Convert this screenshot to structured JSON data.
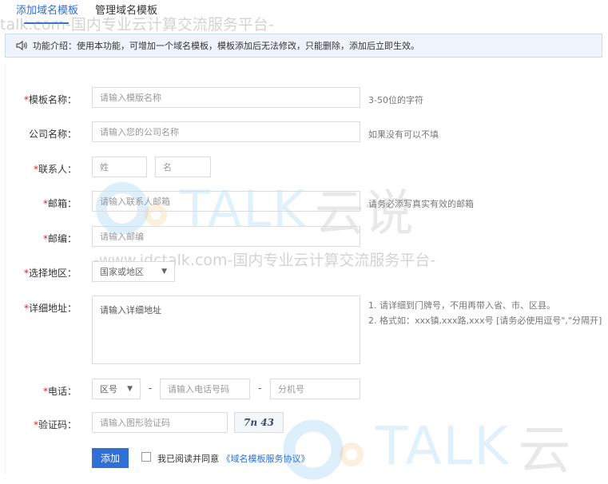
{
  "tabs": [
    {
      "label": "添加域名模板"
    },
    {
      "label": "管理域名模板"
    }
  ],
  "banner": {
    "icon": "speaker-icon",
    "text": "功能介绍：使用本功能，可增加一个域名模板，模板添加后无法修改，只能删除，添加后立即生效。"
  },
  "form": {
    "template_name": {
      "label": "模板名称：",
      "required": true,
      "placeholder": "请输入模版名称",
      "hint": "3-50位的字符"
    },
    "company": {
      "label": "公司名称：",
      "required": false,
      "placeholder": "请输入您的公司名称",
      "hint": "如果没有可以不填"
    },
    "contact": {
      "label": "联系人：",
      "required": true,
      "surname_placeholder": "姓",
      "name_placeholder": "名"
    },
    "email": {
      "label": "邮箱：",
      "required": true,
      "placeholder": "请输入联系人邮箱",
      "hint": "请务必添写真实有效的邮箱"
    },
    "postcode": {
      "label": "邮编：",
      "required": true,
      "placeholder": "请输入邮编"
    },
    "region": {
      "label": "选择地区：",
      "required": true,
      "selected": "国家或地区"
    },
    "address": {
      "label": "详细地址：",
      "required": true,
      "placeholder": "请输入详细地址",
      "hints": [
        "1. 请详细到门牌号，不用再带入省、市、区县。",
        "2. 格式如：xxx镇,xxx路,xxx号 [请务必使用逗号\",\"分隔开]"
      ]
    },
    "phone": {
      "label": "电话：",
      "required": true,
      "area_code": "区号",
      "number_placeholder": "请输入电话号码",
      "ext_placeholder": "分机号",
      "separator": "-"
    },
    "captcha": {
      "label": "验证码：",
      "required": true,
      "placeholder": "请输入图形验证码",
      "image_text": "7n 43"
    },
    "submit_label": "添加",
    "agree_text": "我已阅读并同意",
    "agree_link": "《域名模板服务协议》"
  },
  "watermarks": {
    "top_text": "talk.com-国内专业云计算交流服务平台-",
    "mid_text": "-www.idctalk.com-国内专业云计算交流服务平台-",
    "logo_letters": "TALK",
    "logo_cn": "云说",
    "logo_cn_partial": "云"
  }
}
